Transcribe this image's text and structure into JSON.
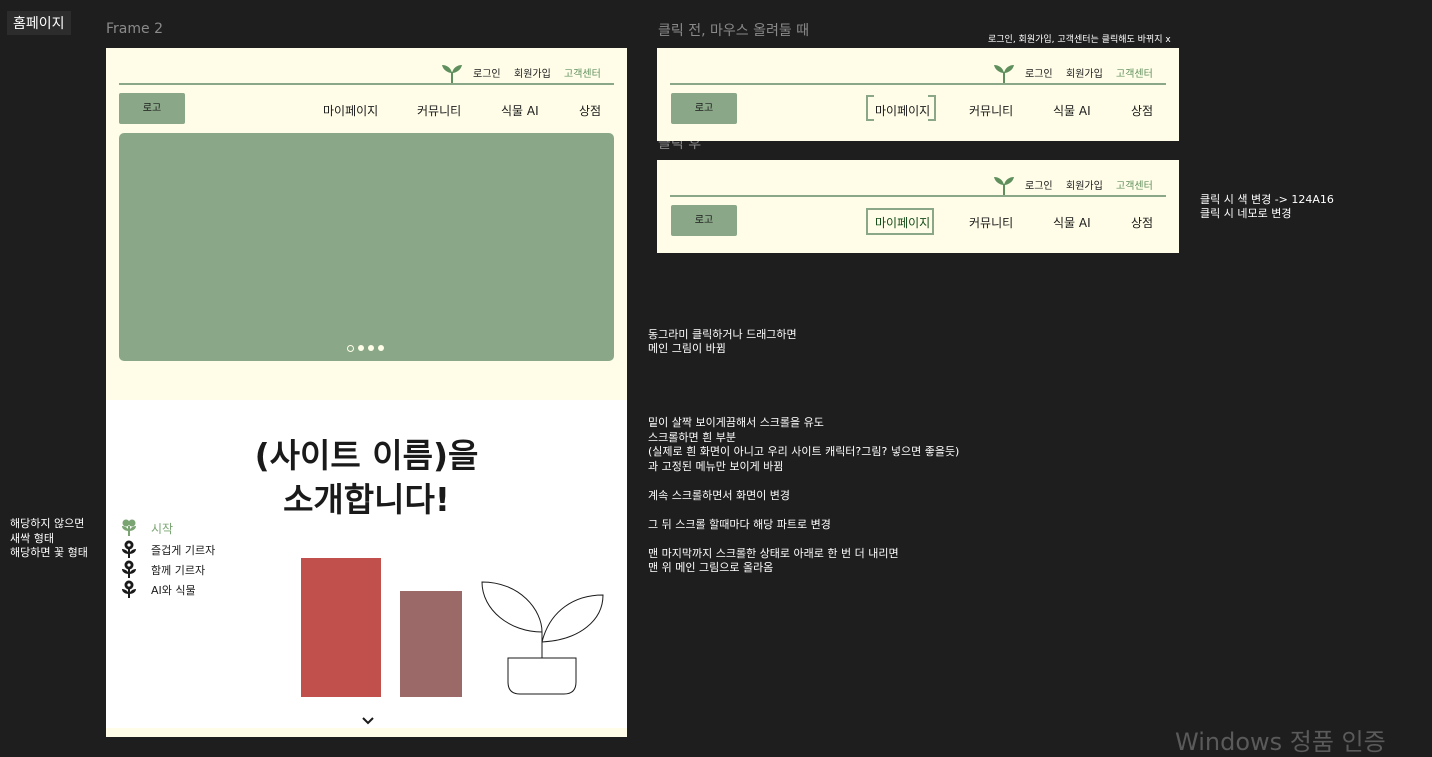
{
  "page_label": "홈페이지",
  "frame_label": "Frame 2",
  "header": {
    "utility_links": [
      "로그인",
      "회원가입",
      "고객센터"
    ],
    "logo_label": "로고",
    "nav_items": [
      "마이페이지",
      "커뮤니티",
      "식물 AI",
      "상점"
    ]
  },
  "banner": {
    "dots": 4,
    "active_dot": 1
  },
  "intro": {
    "title_line1": "(사이트 이름)을",
    "title_line2": "소개합니다!",
    "steps": [
      "시작",
      "즐겁게 기르자",
      "함께 기르자",
      "AI와 식물"
    ],
    "current_step": 1
  },
  "hover_state": {
    "title": "클릭 전, 마우스 올려둘 때",
    "note": "로그인, 회원가입, 고객센터는 클릭해도 바뀌지 x"
  },
  "clicked_state": {
    "title": "클릭 후",
    "note_line1": "클릭 시 색 변경 -> 124A16",
    "note_line2": "클릭 시 네모로 변경"
  },
  "notes": {
    "banner_line1": "동그라미 클릭하거나 드래그하면",
    "banner_line2": "메인 그림이 바뀜",
    "scroll_lines": [
      "밑이 살짝 보이게끔해서 스크롤을 유도",
      "스크롤하면 흰 부분",
      "(실제로 흰 화면이 아니고 우리 사이트 캐릭터?그림? 넣으면 좋을듯)",
      "과 고정된 메뉴만 보이게 바뀜",
      "",
      "계속 스크롤하면서 화면이 변경",
      "",
      "그 뒤 스크롤 할때마다 해당 파트로 변경",
      "",
      "맨 마지막까지 스크롤한 상태로 아래로 한 번 더 내리면",
      "맨 위 메인 그림으로 올라옴"
    ],
    "left_lines": [
      "해당하지 않으면",
      "새싹 형태",
      "해당하면 꽃 형태"
    ]
  },
  "watermark": "Windows 정품 인증",
  "colors": {
    "canvas": "#1e1e1e",
    "cream": "#fffde8",
    "sage": "#8aa888",
    "red_bar": "#c14f4c",
    "mauve_bar": "#9b6968",
    "clicked": "#124A16"
  }
}
